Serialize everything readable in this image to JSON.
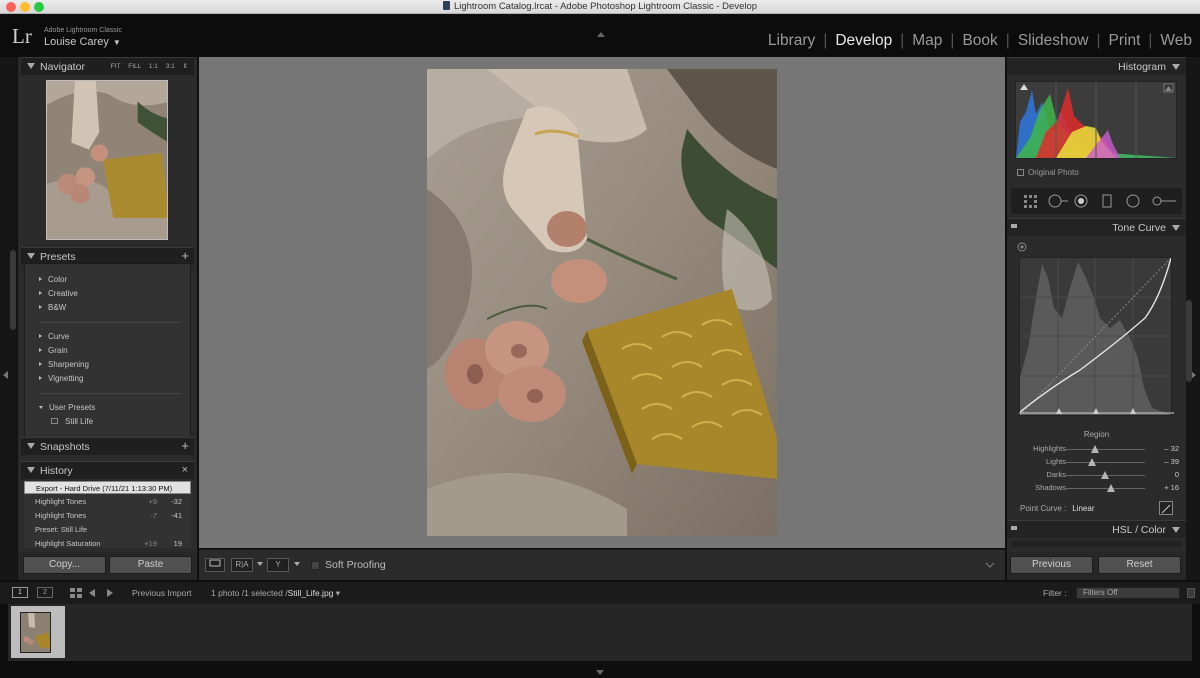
{
  "window": {
    "title": "Lightroom Catalog.lrcat - Adobe Photoshop Lightroom Classic - Develop"
  },
  "identity": {
    "app_name": "Adobe Lightroom Classic",
    "user": "Louise Carey",
    "logo": "Lr"
  },
  "modules": [
    {
      "label": "Library",
      "active": false
    },
    {
      "label": "Develop",
      "active": true
    },
    {
      "label": "Map",
      "active": false
    },
    {
      "label": "Book",
      "active": false
    },
    {
      "label": "Slideshow",
      "active": false
    },
    {
      "label": "Print",
      "active": false
    },
    {
      "label": "Web",
      "active": false
    }
  ],
  "left_panel": {
    "navigator": {
      "title": "Navigator",
      "zoom": [
        "FIT",
        "FILL",
        "1:1",
        "3:1"
      ]
    },
    "presets": {
      "title": "Presets",
      "groups": [
        "Color",
        "Creative",
        "B&W",
        "Curve",
        "Grain",
        "Sharpening",
        "Vignetting"
      ],
      "user_group": "User Presets",
      "user_items": [
        "Still Life"
      ]
    },
    "snapshots": {
      "title": "Snapshots"
    },
    "history": {
      "title": "History",
      "rows": [
        {
          "label": "Export - Hard Drive (7/11/21 1:13:30 PM)",
          "v1": "",
          "v2": "",
          "selected": true
        },
        {
          "label": "Highlight Tones",
          "v1": "+9",
          "v2": "-32",
          "selected": false
        },
        {
          "label": "Highlight Tones",
          "v1": "-7",
          "v2": "-41",
          "selected": false
        },
        {
          "label": "Preset: Still Life",
          "v1": "",
          "v2": "",
          "selected": false
        },
        {
          "label": "Highlight Saturation",
          "v1": "+19",
          "v2": "19",
          "selected": false
        }
      ]
    },
    "buttons": {
      "copy": "Copy...",
      "paste": "Paste"
    }
  },
  "toolbar": {
    "soft_proofing": "Soft Proofing",
    "compare_label": "R|A"
  },
  "right_panel": {
    "histogram": {
      "title": "Histogram",
      "original_photo": "Original Photo"
    },
    "tone_curve": {
      "title": "Tone Curve",
      "region_label": "Region",
      "sliders": [
        {
          "name": "Highlights",
          "value": "– 32",
          "pos": 0.38
        },
        {
          "name": "Lights",
          "value": "– 39",
          "pos": 0.34
        },
        {
          "name": "Darks",
          "value": "0",
          "pos": 0.5
        },
        {
          "name": "Shadows",
          "value": "+ 16",
          "pos": 0.58
        }
      ],
      "point_curve_label": "Point Curve :",
      "point_curve_value": "Linear"
    },
    "hsl": {
      "title": "HSL / Color"
    },
    "buttons": {
      "previous": "Previous",
      "reset": "Reset"
    }
  },
  "filmstrip": {
    "monitor1": "1",
    "monitor2": "2",
    "source": "Previous Import",
    "count": "1 photo /1 selected /",
    "filename": "Still_Life.jpg",
    "filter_label": "Filter :",
    "filter_value": "Filters Off"
  }
}
